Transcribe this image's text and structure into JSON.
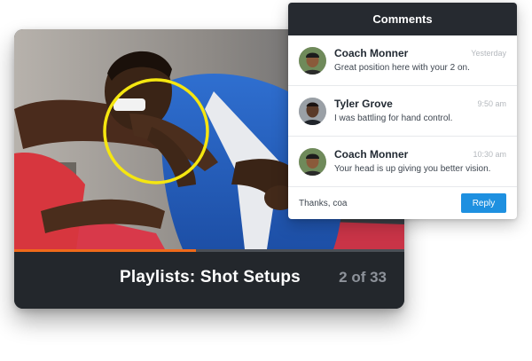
{
  "video": {
    "playlist_title": "Playlists: Shot Setups",
    "playlist_position": "2 of 33",
    "progress_fraction": 0.465,
    "colors": {
      "progress": "#ef6a1a",
      "highlight_circle": "#f5e610",
      "bar": "#23272c"
    }
  },
  "comments": {
    "header": "Comments",
    "items": [
      {
        "author": "Coach Monner",
        "time": "Yesterday",
        "text": "Great position here with your 2 on.",
        "avatar": "coach-avatar"
      },
      {
        "author": "Tyler Grove",
        "time": "9:50 am",
        "text": "I was battling for hand control.",
        "avatar": "athlete-avatar"
      },
      {
        "author": "Coach Monner",
        "time": "10:30 am",
        "text": "Your head is up giving you better vision.",
        "avatar": "coach-avatar"
      }
    ],
    "reply": {
      "value": "Thanks, coa",
      "button_label": "Reply",
      "button_color": "#1e90e0"
    }
  }
}
